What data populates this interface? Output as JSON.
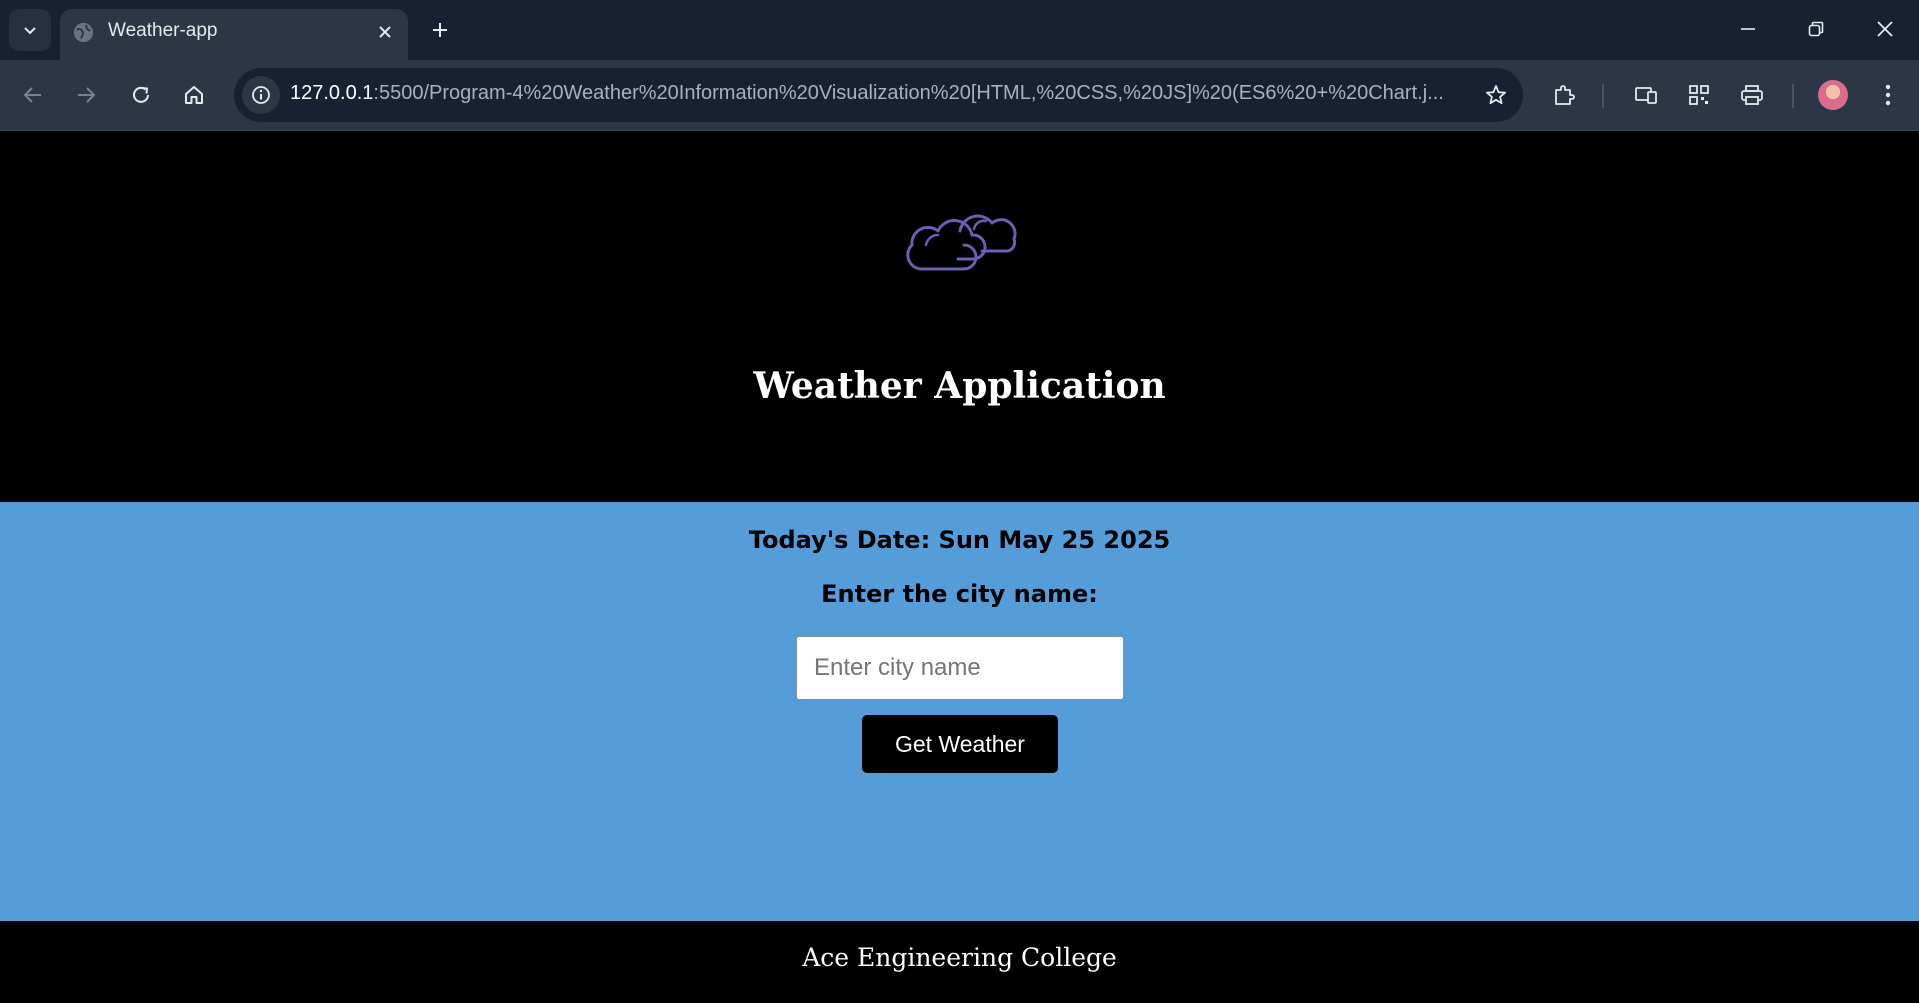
{
  "browser": {
    "tab_title": "Weather-app",
    "url_host": "127.0.0.1",
    "url_rest": ":5500/Program-4%20Weather%20Information%20Visualization%20[HTML,%20CSS,%20JS]%20(ES6%20+%20Chart.j...",
    "icons": {
      "tab_list": "chevron-down-icon",
      "favicon": "globe-icon",
      "tab_close": "close-icon",
      "new_tab": "plus-icon",
      "minimize": "minimize-icon",
      "restore": "restore-icon",
      "close_window": "close-icon",
      "back": "arrow-left-icon",
      "forward": "arrow-right-icon",
      "reload": "reload-icon",
      "home": "home-icon",
      "site_info": "info-icon",
      "bookmark": "star-icon",
      "extensions": "puzzle-icon",
      "cast": "devices-icon",
      "qr": "qr-code-icon",
      "print": "printer-icon",
      "profile": "avatar",
      "menu": "kebab-menu-icon"
    },
    "colors": {
      "tabbar": "#172131",
      "toolbar": "#2c3645"
    }
  },
  "app": {
    "logo": "cloud-icon",
    "title": "Weather Application",
    "date_text": "Today's Date: Sun May 25 2025",
    "city_label": "Enter the city name:",
    "city_input_value": "",
    "city_input_placeholder": "Enter city name",
    "button_label": "Get Weather",
    "footer_text": "Ace Engineering College",
    "colors": {
      "hero_bg": "#000000",
      "form_bg": "#559dd9",
      "button_bg": "#000000",
      "logo_stroke": "#6a5fb5"
    }
  }
}
